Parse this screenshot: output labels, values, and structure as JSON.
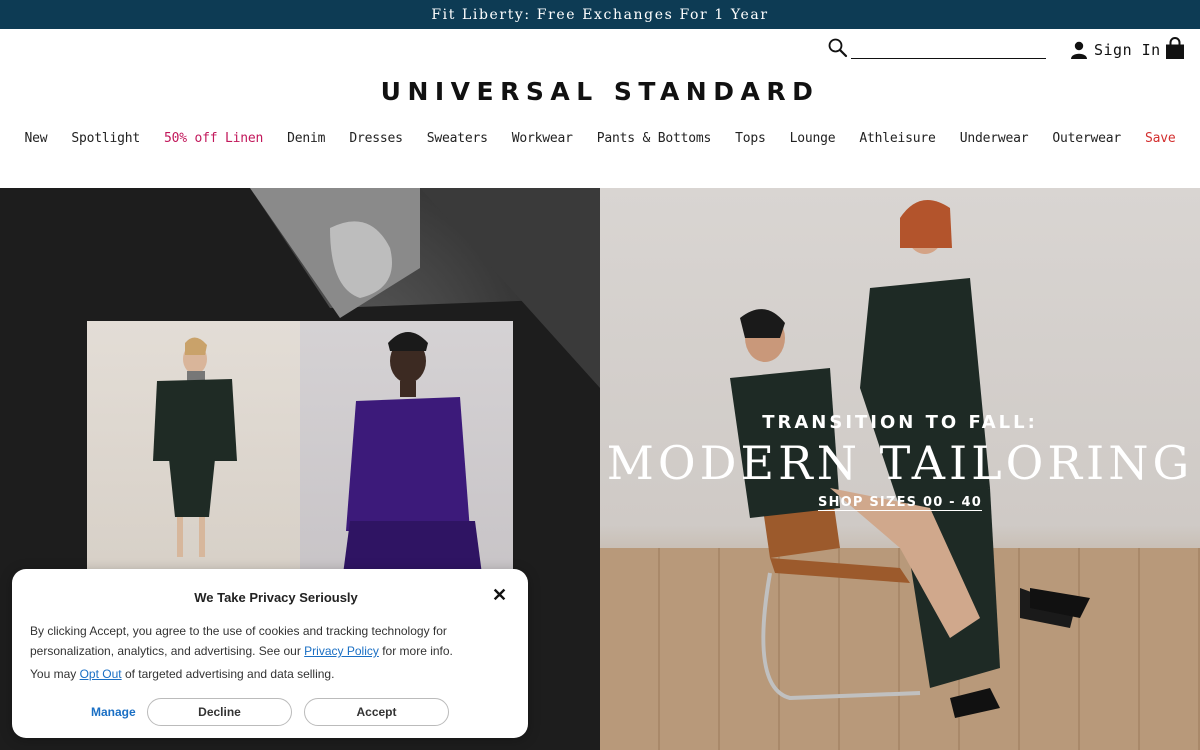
{
  "promo": {
    "text": "Fit Liberty: Free Exchanges For 1 Year"
  },
  "header": {
    "logo": "UNIVERSAL STANDARD",
    "search": {
      "value": "",
      "placeholder": ""
    },
    "sign_in": "Sign In"
  },
  "nav": {
    "items": [
      {
        "label": "New"
      },
      {
        "label": "Spotlight"
      },
      {
        "label": "50% off Linen"
      },
      {
        "label": "Denim"
      },
      {
        "label": "Dresses"
      },
      {
        "label": "Sweaters"
      },
      {
        "label": "Workwear"
      },
      {
        "label": "Pants & Bottoms"
      },
      {
        "label": "Tops"
      },
      {
        "label": "Lounge"
      },
      {
        "label": "Athleisure"
      },
      {
        "label": "Underwear"
      },
      {
        "label": "Outerwear"
      },
      {
        "label": "Save"
      }
    ]
  },
  "hero": {
    "kicker": "TRANSITION TO FALL:",
    "headline": "MODERN TAILORING",
    "cta": "SHOP SIZES 00 - 40"
  },
  "privacy": {
    "title": "We Take Privacy Seriously",
    "close": "✕",
    "body_before": "By clicking Accept, you agree to the use of cookies and tracking technology for personalization, analytics, and advertising. See our ",
    "policy_link": "Privacy Policy",
    "body_after": " for more info.",
    "optout_before": "You may ",
    "optout_link": "Opt Out",
    "optout_after": " of targeted advertising and data selling.",
    "manage": "Manage",
    "decline": "Decline",
    "accept": "Accept"
  },
  "colors": {
    "promo_bg": "#0d3b54",
    "linen_accent": "#c2185b",
    "save_accent": "#d32f2f",
    "link": "#1a6fc4"
  },
  "icons": {
    "search": "search-icon",
    "user": "user-icon",
    "bag": "shopping-bag-icon",
    "close": "close-icon"
  }
}
